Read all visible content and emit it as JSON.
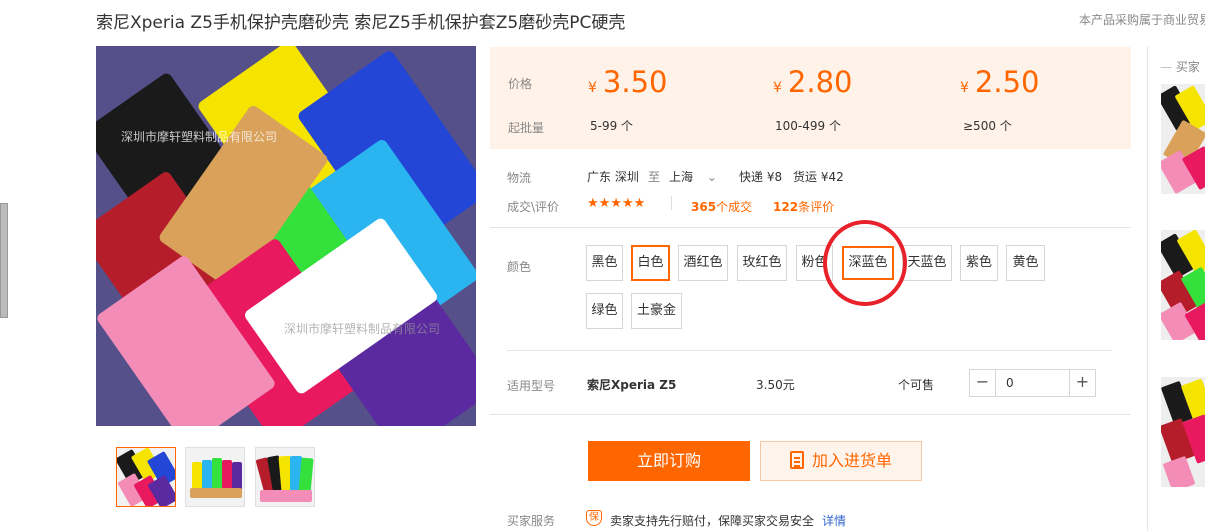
{
  "title": "索尼Xperia Z5手机保护壳磨砂壳 索尼Z5手机保护套Z5磨砂壳PC硬壳",
  "top_note": "本产品采购属于商业贸易",
  "watermark": "深圳市摩轩塑料制品有限公司",
  "price": {
    "price_label": "价格",
    "batch_label": "起批量",
    "currency": "¥",
    "tiers": [
      {
        "price": "3.50",
        "range": "5-99 个"
      },
      {
        "price": "2.80",
        "range": "100-499 个"
      },
      {
        "price": "2.50",
        "range": "≥500 个"
      }
    ]
  },
  "logistics": {
    "label": "物流",
    "origin": "广东 深圳",
    "to": "至",
    "destination": "上海",
    "express": "快递 ¥8",
    "freight": "货运 ¥42"
  },
  "deals": {
    "label": "成交\\评价",
    "stars": "★★★★★",
    "deal_count": "365",
    "deal_suffix": "个成交",
    "review_count": "122",
    "review_suffix": "条评价"
  },
  "colors": {
    "label": "颜色",
    "options": [
      "黑色",
      "白色",
      "酒红色",
      "玫红色",
      "粉色",
      "深蓝色",
      "天蓝色",
      "紫色",
      "黄色",
      "绿色",
      "土豪金"
    ],
    "selected": "白色",
    "highlighted": "深蓝色",
    "highlight_color": "#e8212a"
  },
  "model": {
    "label": "适用型号",
    "name": "索尼Xperia Z5",
    "price": "3.50元",
    "stock": "个可售",
    "quantity": "0",
    "minus": "−",
    "plus": "+"
  },
  "actions": {
    "order": "立即订购",
    "cart": "加入进货单"
  },
  "service": {
    "label": "买家服务",
    "badge": "保",
    "text": "卖家支持先行赔付，保障买家交易安全",
    "link": "详情"
  },
  "sidebar": {
    "header": "买家"
  },
  "accent_color": "#ff6600"
}
